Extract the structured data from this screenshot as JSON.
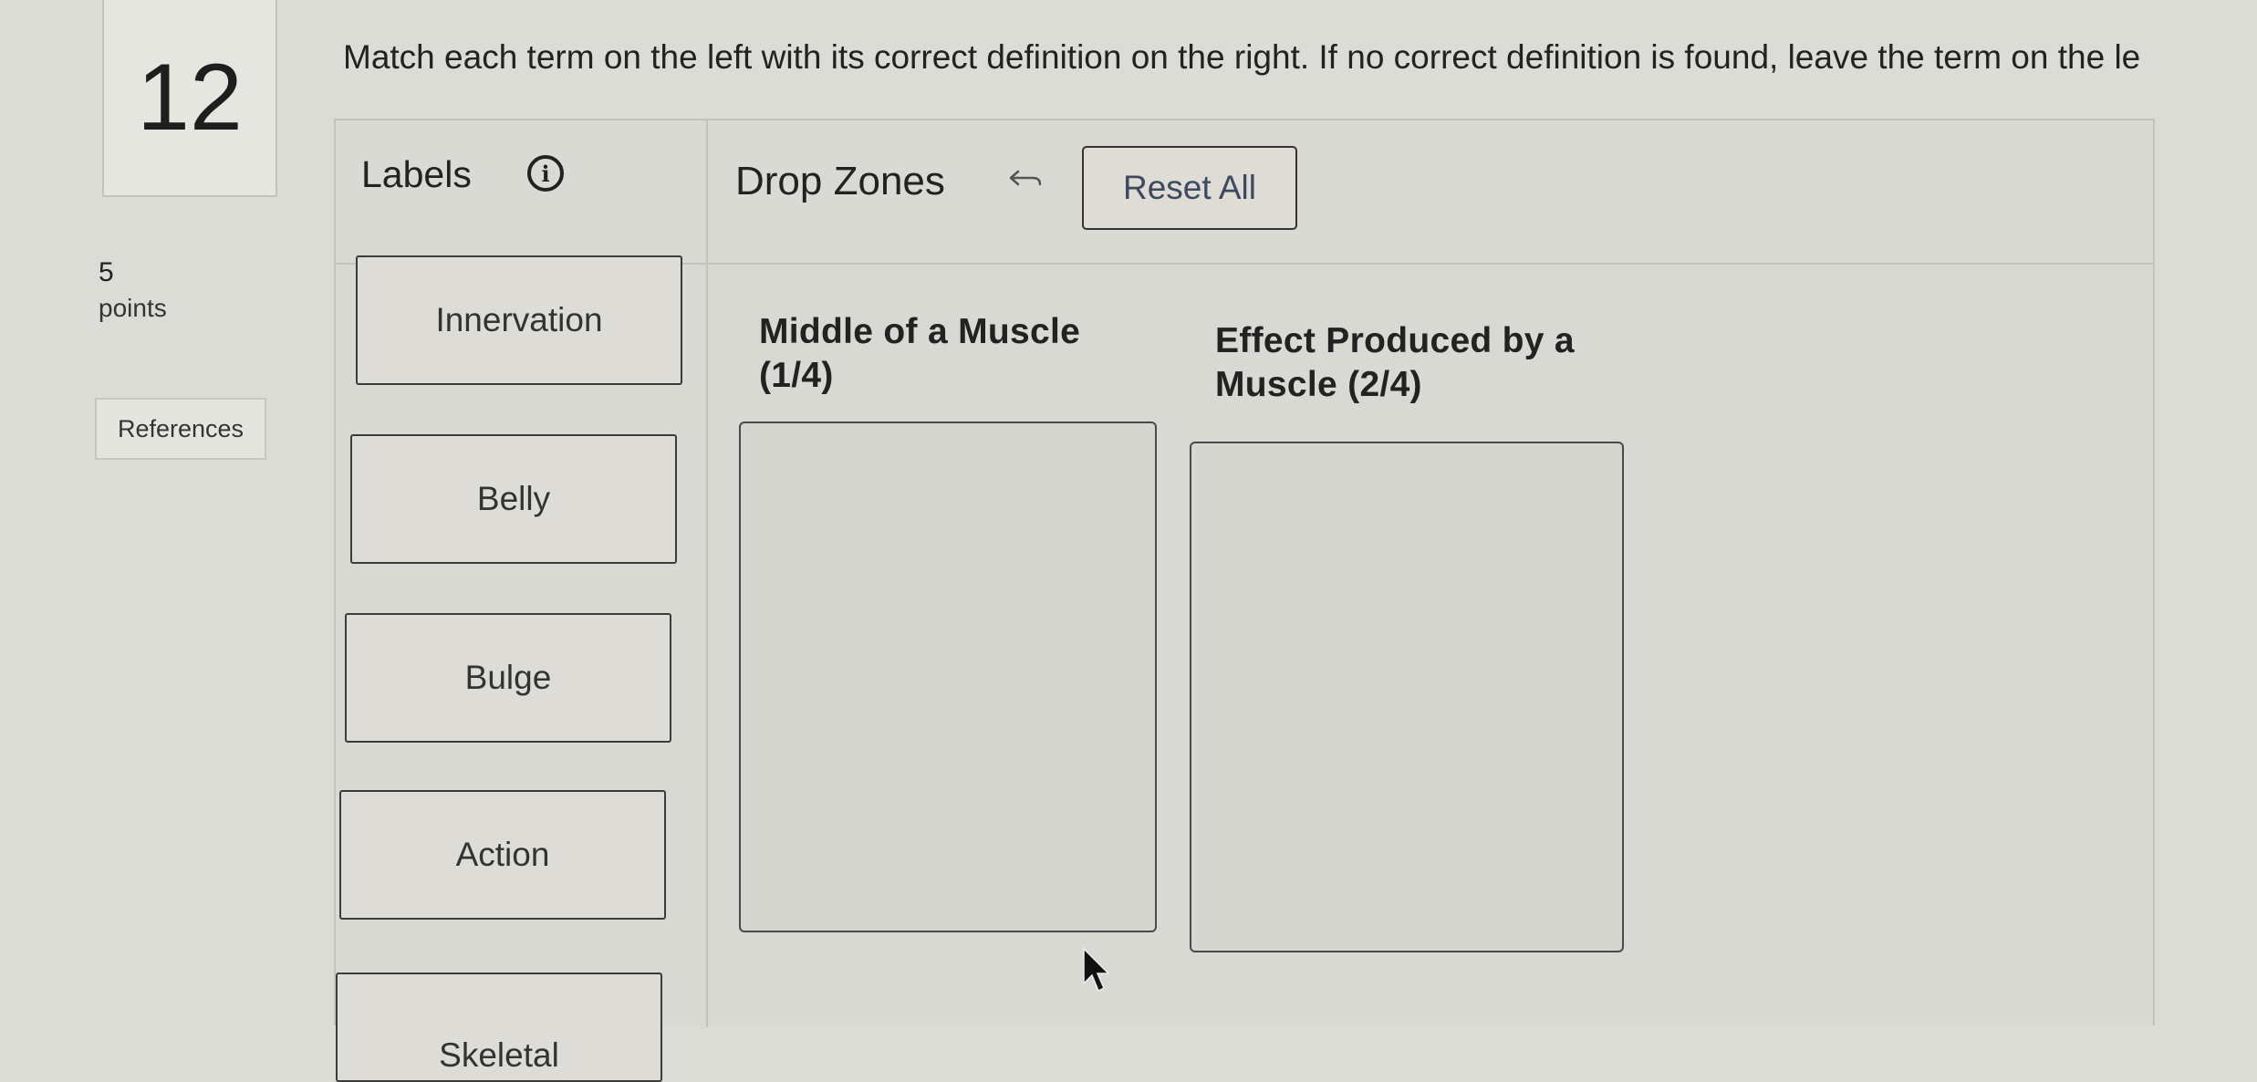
{
  "question": {
    "number": "12",
    "points_value": "5",
    "points_label": "points",
    "references_label": "References",
    "instructions": "Match each term on the left with its correct definition on the right. If no correct definition is found, leave the term on the le"
  },
  "labels_panel": {
    "title": "Labels",
    "info_icon": "info-circle-icon",
    "items": [
      "Innervation",
      "Belly",
      "Bulge",
      "Action",
      "Skeletal"
    ]
  },
  "drop_zones_panel": {
    "title": "Drop Zones",
    "undo_icon": "undo-arrow-icon",
    "reset_label": "Reset All",
    "zones": [
      {
        "line1": "Middle of a Muscle",
        "line2": "(1/4)"
      },
      {
        "line1": "Effect Produced by a",
        "line2": "Muscle (2/4)"
      }
    ]
  }
}
